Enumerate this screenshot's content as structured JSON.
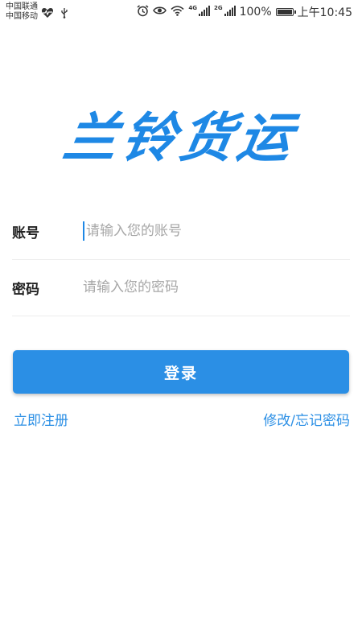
{
  "status_bar": {
    "carrier_1": "中国联通",
    "carrier_2": "中国移动",
    "net_tag_1": "4G",
    "net_tag_2": "2G",
    "battery_percent": "100%",
    "battery_level": 1.0,
    "time": "上午10:45",
    "icons": [
      "heart-pulse-icon",
      "usb-icon",
      "alarm-icon",
      "eye-icon",
      "wifi-icon",
      "signal-icon",
      "battery-icon"
    ]
  },
  "logo": {
    "text": "兰铃货运",
    "color": "#1e88e5"
  },
  "form": {
    "account_label": "账号",
    "account_placeholder": "请输入您的账号",
    "account_value": "",
    "password_label": "密码",
    "password_placeholder": "请输入您的密码",
    "password_value": ""
  },
  "login_button": {
    "label": "登录",
    "color": "#2b8fe5"
  },
  "links": {
    "register": "立即注册",
    "forgot": "修改/忘记密码"
  }
}
